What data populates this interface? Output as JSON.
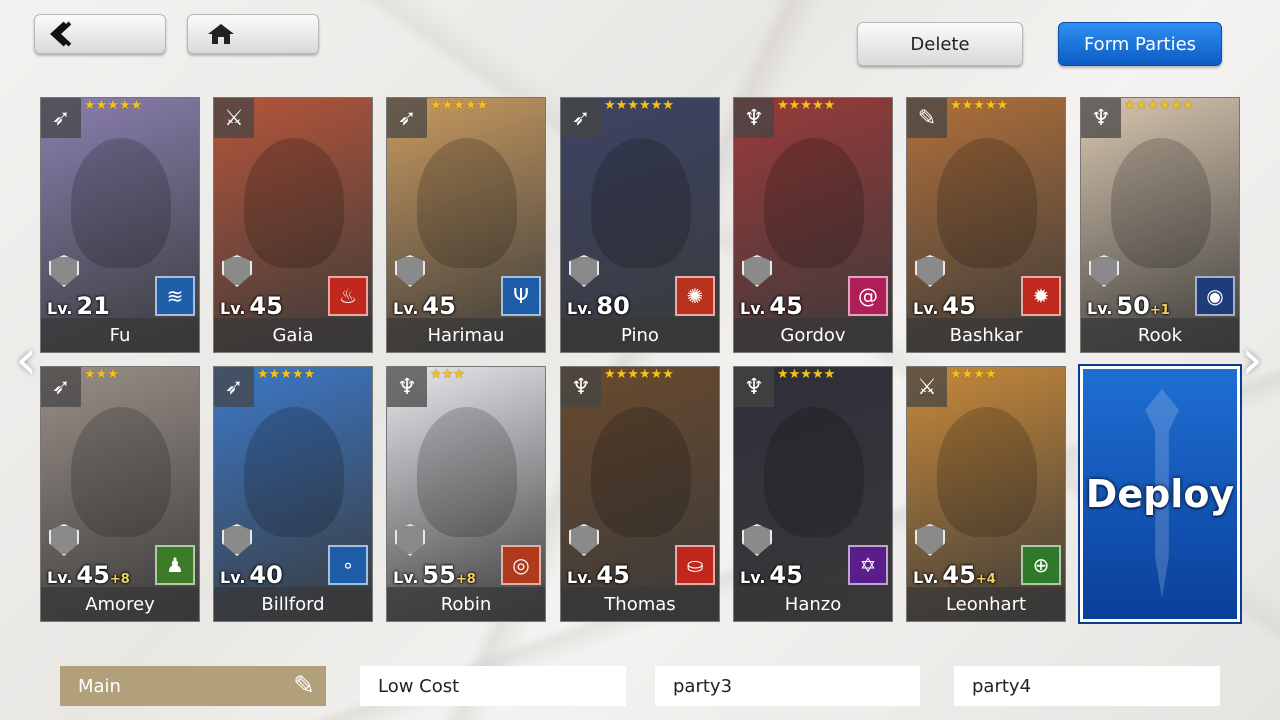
{
  "header": {
    "back_icon": "back-arrow-icon",
    "home_icon": "home-icon",
    "delete_label": "Delete",
    "form_parties_label": "Form Parties"
  },
  "characters": [
    {
      "name": "Fu",
      "level": "21",
      "plus": "",
      "stars": "★★★★★",
      "class_icon": "bow-icon",
      "element_icon": "water-swirl-icon",
      "element_color": "#1f5fa8",
      "art_color": "#8a7fb0"
    },
    {
      "name": "Gaia",
      "level": "45",
      "plus": "",
      "stars": "",
      "class_icon": "crossed-swords-icon",
      "element_icon": "fire-icon",
      "element_color": "#c0281e",
      "art_color": "#b4553a"
    },
    {
      "name": "Harimau",
      "level": "45",
      "plus": "",
      "stars": "★★★★★",
      "class_icon": "bow-icon",
      "element_icon": "trident-icon",
      "element_color": "#1e5ca8",
      "art_color": "#c89a60"
    },
    {
      "name": "Pino",
      "level": "80",
      "plus": "",
      "stars": "★★★★★★",
      "class_icon": "bow-icon",
      "element_icon": "sunburst-icon",
      "element_color": "#b8321e",
      "art_color": "#3c4466"
    },
    {
      "name": "Gordov",
      "level": "45",
      "plus": "",
      "stars": "★★★★★",
      "class_icon": "lyre-icon",
      "element_icon": "spiral-icon",
      "element_color": "#b01e57",
      "art_color": "#9a3a3a"
    },
    {
      "name": "Bashkar",
      "level": "45",
      "plus": "",
      "stars": "★★★★★",
      "class_icon": "feather-icon",
      "element_icon": "figure-icon",
      "element_color": "#c02a1e",
      "art_color": "#b0703a"
    },
    {
      "name": "Rook",
      "level": "50",
      "plus": "+1",
      "stars": "★★★★★★",
      "class_icon": "lyre-icon",
      "element_icon": "bag-icon",
      "element_color": "#1f3c7a",
      "art_color": "#d9c7b0"
    },
    {
      "name": "Amorey",
      "level": "45",
      "plus": "+8",
      "stars": "★★★",
      "class_icon": "bow-icon",
      "element_icon": "figure-icon",
      "element_color": "#3a7a28",
      "art_color": "#9a8f88"
    },
    {
      "name": "Billford",
      "level": "40",
      "plus": "",
      "stars": "★★★★★",
      "class_icon": "bow-icon",
      "element_icon": "bubbles-icon",
      "element_color": "#1e5ca8",
      "art_color": "#3c78c8"
    },
    {
      "name": "Robin",
      "level": "55",
      "plus": "+8",
      "stars": "★★★",
      "class_icon": "lyre-icon",
      "element_icon": "plate-icon",
      "element_color": "#b03a1e",
      "art_color": "#e8e8ee"
    },
    {
      "name": "Thomas",
      "level": "45",
      "plus": "",
      "stars": "★★★★★★",
      "class_icon": "lyre-icon",
      "element_icon": "coins-icon",
      "element_color": "#c0281e",
      "art_color": "#6a4a2e"
    },
    {
      "name": "Hanzo",
      "level": "45",
      "plus": "",
      "stars": "★★★★★",
      "class_icon": "lyre-icon",
      "element_icon": "pentagram-icon",
      "element_color": "#5a1e8a",
      "art_color": "#2e2e3a"
    },
    {
      "name": "Leonhart",
      "level": "45",
      "plus": "+4",
      "stars": "★★★★",
      "class_icon": "crossed-swords-icon",
      "element_icon": "crosshair-icon",
      "element_color": "#2f7a2a",
      "art_color": "#c88a3a"
    }
  ],
  "deploy_label": "Deploy",
  "navigation": {
    "left_icon": "chevron-left-icon",
    "right_icon": "chevron-right-icon"
  },
  "parties": [
    {
      "label": "Main",
      "selected": true
    },
    {
      "label": "Low Cost",
      "selected": false
    },
    {
      "label": "party3",
      "selected": false
    },
    {
      "label": "party4",
      "selected": false
    }
  ],
  "edit_icon": "pencil-icon"
}
